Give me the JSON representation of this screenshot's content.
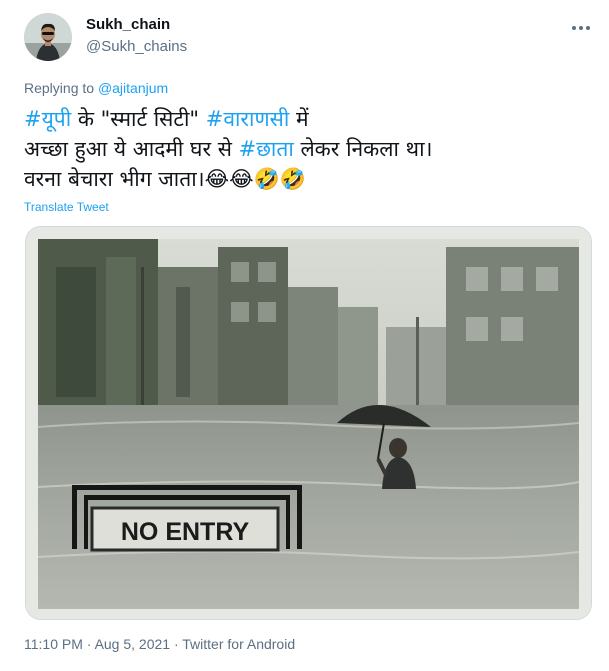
{
  "user": {
    "display_name": "Sukh_chain",
    "handle": "@Sukh_chains"
  },
  "reply": {
    "prefix": "Replying to",
    "to": "@ajitanjum"
  },
  "tweet": {
    "line1": {
      "tag1": "#यूपी",
      "text1": " के \"स्मार्ट सिटी\" ",
      "tag2": "#वाराणसी",
      "text2": " में"
    },
    "line2": {
      "text1": "अच्छा हुआ ये आदमी घर से ",
      "tag1": "#छाता",
      "text2": " लेकर निकला था।"
    },
    "line3": {
      "text1": "वरना बेचारा भीग जाता।",
      "emojis": "😂😂🤣🤣"
    }
  },
  "translate_label": "Translate Tweet",
  "media": {
    "sign_text": "NO ENTRY"
  },
  "meta": {
    "time": "11:10 PM",
    "sep1": " · ",
    "date": "Aug 5, 2021",
    "sep2": " · ",
    "source": "Twitter for Android"
  },
  "colors": {
    "link": "#1da1f2",
    "secondary_text": "#5b7083",
    "primary_text": "#0f1419"
  },
  "icons": {
    "more": "more-horizontal-icon"
  }
}
